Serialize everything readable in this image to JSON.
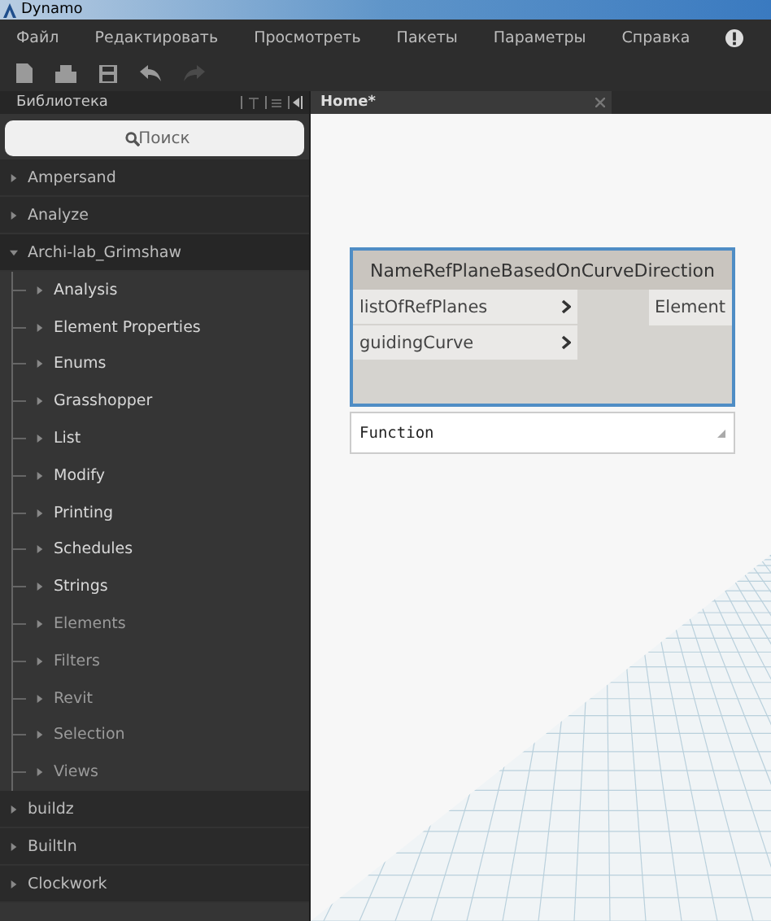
{
  "window": {
    "title": "Dynamo"
  },
  "menu": [
    "Файл",
    "Редактировать",
    "Просмотреть",
    "Пакеты",
    "Параметры",
    "Справка"
  ],
  "toolbar": [
    {
      "kind": "new",
      "disabled": false
    },
    {
      "kind": "open",
      "disabled": false
    },
    {
      "kind": "save",
      "disabled": false
    },
    {
      "kind": "undo",
      "disabled": false
    },
    {
      "kind": "redo",
      "disabled": true
    }
  ],
  "library": {
    "title": "Библиотека",
    "search": {
      "placeholder": "Поиск"
    },
    "categories": [
      {
        "label": "Ampersand",
        "expanded": false
      },
      {
        "label": "Analyze",
        "expanded": false
      },
      {
        "label": "Archi-lab_Grimshaw",
        "expanded": true,
        "groups": [
          {
            "dimmed": false,
            "children": [
              "Analysis",
              "Element Properties",
              "Enums",
              "Grasshopper",
              "List",
              "Modify",
              "Printing",
              "Schedules",
              "Strings"
            ]
          },
          {
            "dimmed": true,
            "children": [
              "Elements",
              "Filters",
              "Revit",
              "Selection",
              "Views"
            ]
          }
        ]
      },
      {
        "label": "buildz",
        "expanded": false
      },
      {
        "label": "BuiltIn",
        "expanded": false
      },
      {
        "label": "Clockwork",
        "expanded": false
      }
    ]
  },
  "tabs": [
    {
      "label": "Home*",
      "selected": true
    }
  ],
  "node": {
    "title": "NameRefPlaneBasedOnCurveDirection",
    "inputs": [
      "listOfRefPlanes",
      "guidingCurve"
    ],
    "outputs": [
      "Element"
    ],
    "selected": true,
    "lacing": "Function"
  }
}
